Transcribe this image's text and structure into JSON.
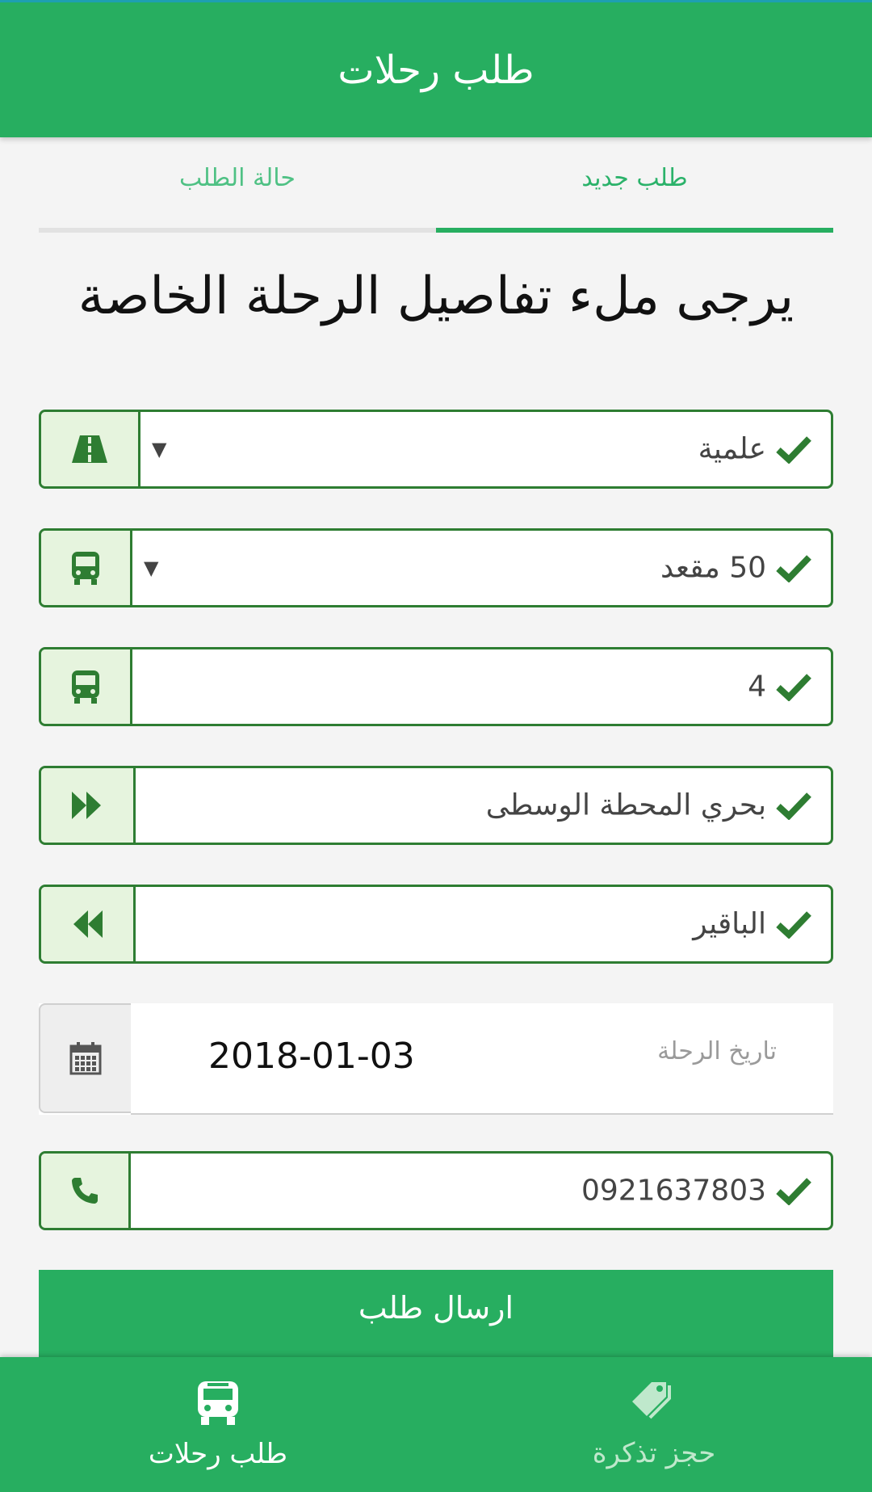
{
  "header": {
    "title": "طلب رحلات"
  },
  "tabs": {
    "status": "حالة الطلب",
    "new": "طلب جديد"
  },
  "heading": "يرجى ملء تفاصيل الرحلة الخاصة",
  "fields": {
    "trip_type": "علمية",
    "seats": "50 مقعد",
    "bus_count": "4",
    "from": "بحري المحطة الوسطى",
    "to": "الباقير",
    "phone": "0921637803"
  },
  "date_field": {
    "label": "تاريخ الرحلة",
    "value": "2018-01-03"
  },
  "submit": {
    "label": "ارسال طلب"
  },
  "bottom_nav": {
    "trips": "طلب رحلات",
    "ticket": "حجز تذكرة"
  },
  "colors": {
    "primary": "#27ae60",
    "border": "#2e7d32",
    "icon_bg": "#e6f4de"
  }
}
